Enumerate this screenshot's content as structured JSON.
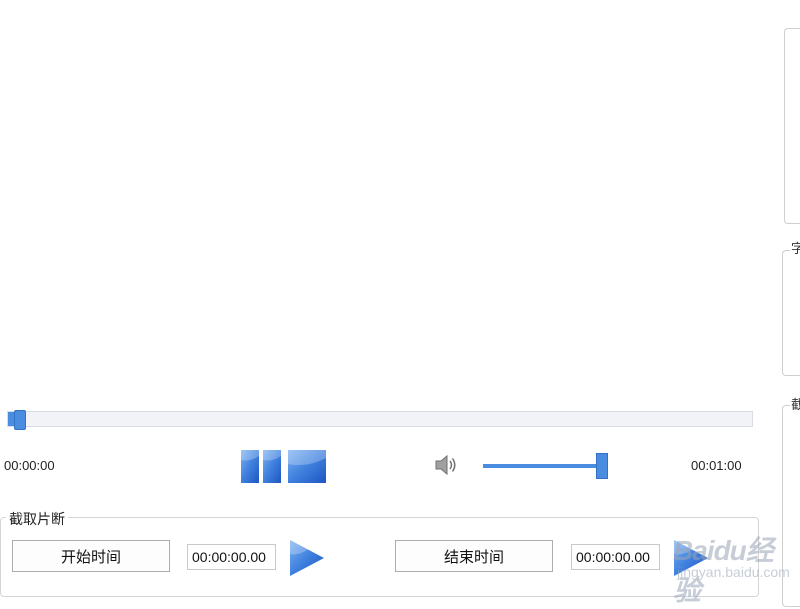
{
  "player": {
    "current_time": "00:00:00",
    "total_time": "00:01:00",
    "progress": 0.008,
    "volume": 0.99
  },
  "side_panels": {
    "panel2_label": "字",
    "panel3_label": "截"
  },
  "clip": {
    "title": "截取片断",
    "start_button_label": "开始时间",
    "start_time_value": "00:00:00.00",
    "end_button_label": "结束时间",
    "end_time_value": "00:00:00.00"
  },
  "watermark": {
    "brand": "Baidu经验",
    "sub": "jingyan.baidu.com"
  },
  "icons": {
    "pause": "pause-icon",
    "stop": "stop-icon",
    "volume": "volume-icon",
    "play": "play-icon"
  },
  "colors": {
    "accent": "#4a8de0",
    "button_gradient_top": "#6fa8ef",
    "button_gradient_bottom": "#2360c9"
  }
}
